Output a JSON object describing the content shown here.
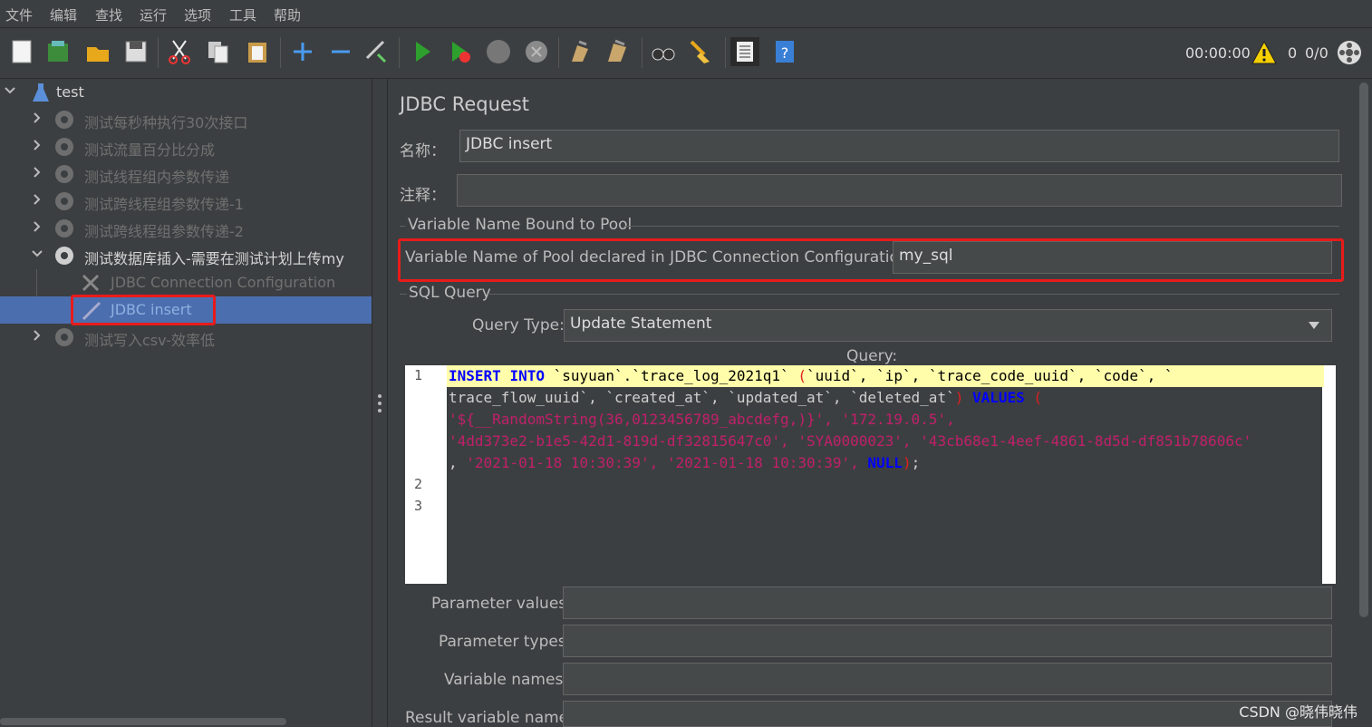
{
  "menu": [
    "文件",
    "编辑",
    "查找",
    "运行",
    "选项",
    "工具",
    "帮助"
  ],
  "toolbar": {
    "timer": "00:00:00",
    "warning_count": "0",
    "threads": "0/0"
  },
  "tree": {
    "root": "test",
    "items": [
      {
        "label": "测试每秒种执行30次接口"
      },
      {
        "label": "测试流量百分比分成"
      },
      {
        "label": "测试线程组内参数传递"
      },
      {
        "label": "测试跨线程组参数传递-1"
      },
      {
        "label": "测试跨线程组参数传递-2"
      },
      {
        "label": "测试数据库插入-需要在测试计划上传my"
      },
      {
        "label": "JDBC Connection Configuration"
      },
      {
        "label": "JDBC insert"
      },
      {
        "label": "测试写入csv-效率低"
      }
    ]
  },
  "panel": {
    "title": "JDBC Request",
    "name_label": "名称：",
    "name_value": "JDBC insert",
    "comment_label": "注释：",
    "comment_value": "",
    "pool_section": "Variable Name Bound to Pool",
    "pool_label": "Variable Name of Pool declared in JDBC Connection Configuration:",
    "pool_value": "my_sql",
    "sql_section": "SQL Query",
    "query_type_label": "Query Type:",
    "query_type_value": "Update Statement",
    "query_label": "Query:",
    "param_values_label": "Parameter values:",
    "param_types_label": "Parameter types:",
    "var_names_label": "Variable names:",
    "result_var_label": "Result variable name:"
  },
  "editor": {
    "line_numbers": [
      "1",
      "2",
      "3"
    ],
    "line1_a": "INSERT",
    "line1_b": "INTO",
    "line1_c": "`suyuan`.`trace_log_2021q1`",
    "line1_d": "(",
    "line1_e": "`uuid`, `ip`, `trace_code_uuid`, `code`, `",
    "line1w_a": "trace_flow_uuid`, `created_at`, `updated_at`, `deleted_at`",
    "line1w_b": ")",
    "line1w_c": "VALUES",
    "line1w_d": "(",
    "line1w2": "'${__RandomString(36,0123456789_abcdefg,)}', '172.19.0.5',",
    "line1w3": "'4dd373e2-b1e5-42d1-819d-df32815647c0', 'SYA0000023', '43cb68e1-4eef-4861-8d5d-df851b78606c'",
    "line1w4_a": ",",
    "line1w4_b": "'2021-01-18 10:30:39', '2021-01-18 10:30:39',",
    "line1w4_c": "NULL",
    "line1w4_d": ")",
    "line1w4_e": ";"
  },
  "watermark": "CSDN @晓伟晓伟",
  "colors": {
    "background": "#3c3f41",
    "selection": "#4b6eaf",
    "highlight_box": "#e81b1b",
    "keyword": "#0000ff",
    "string": "#c0206a"
  }
}
